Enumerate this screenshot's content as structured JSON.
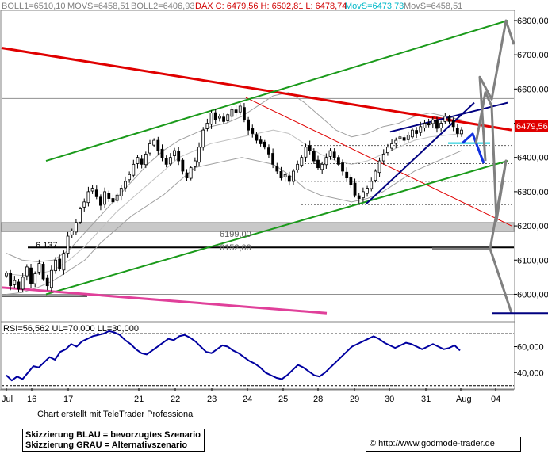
{
  "header": {
    "boll1": "BOLL1=6510,10",
    "movs": "MOVS=6458,51",
    "boll2": "BOLL2=6406,93",
    "dax": "DAX C: 6479,56 H: 6502,81 L: 6478,74",
    "movs_cyan": "MovS=6473,73",
    "movs2": "MovS=6458,51"
  },
  "rsi_header": "RSI=56,562 UL=70,000 LL=30,000",
  "footer": {
    "credit": "Chart erstellt mit TeleTrader Professional",
    "legend_blue": "Skizzierung BLAU = bevorzugtes Szenario",
    "legend_grey": "Skizzierung GRAU = Alternativszenario",
    "copyright": "© http://www.godmode-trader.de"
  },
  "colors": {
    "bg": "#ffffff",
    "red_resistance": "#e00000",
    "green_channel": "#1a9a1a",
    "navy_trend": "#000080",
    "blue_scenario": "#1030e0",
    "grey_scenario": "#808080",
    "magenta_line": "#e0409a",
    "cyan_line": "#00c8d8",
    "candle": "#000000",
    "band": "#a0a0a0",
    "price_tag": "#e00000"
  },
  "chart_data": [
    {
      "type": "candlestick",
      "title": "DAX",
      "ylim": [
        5920,
        6830
      ],
      "y_ticks": [
        "6800,00",
        "6700,00",
        "6600,00",
        "6500,00",
        "6400,00",
        "6300,00",
        "6200,00",
        "6100,00",
        "6000,00"
      ],
      "x_ticks": [
        "Jul",
        "16",
        "17",
        "21",
        "22",
        "23",
        "24",
        "25",
        "28",
        "29",
        "30",
        "31",
        "Aug",
        "04"
      ],
      "last_price": "6479,56",
      "annotations": {
        "zone_label": "6199,00",
        "line_6152": "6152,00",
        "low_label": "6.137"
      },
      "levels": {
        "zone_top": 6210,
        "zone_bottom": 6183,
        "support_6137": 6137,
        "support_6000": 6000,
        "resistance_6572": 6572,
        "dotted_6435": 6435,
        "dotted_6382": 6382,
        "dotted_6330": 6330,
        "dotted_6262": 6262
      },
      "closes": [
        6062,
        6025,
        6040,
        6015,
        6050,
        6080,
        6030,
        6060,
        6090,
        6045,
        6025,
        6070,
        6100,
        6075,
        6120,
        6170,
        6185,
        6210,
        6250,
        6270,
        6300,
        6310,
        6285,
        6260,
        6300,
        6280,
        6270,
        6290,
        6310,
        6330,
        6350,
        6380,
        6400,
        6380,
        6410,
        6440,
        6450,
        6420,
        6400,
        6380,
        6400,
        6420,
        6390,
        6360,
        6340,
        6370,
        6390,
        6430,
        6480,
        6500,
        6530,
        6510,
        6520,
        6505,
        6525,
        6540,
        6530,
        6550,
        6510,
        6480,
        6470,
        6450,
        6440,
        6430,
        6410,
        6380,
        6360,
        6340,
        6350,
        6330,
        6360,
        6380,
        6400,
        6430,
        6420,
        6390,
        6370,
        6380,
        6400,
        6420,
        6400,
        6380,
        6360,
        6340,
        6320,
        6290,
        6280,
        6300,
        6310,
        6330,
        6360,
        6390,
        6410,
        6430,
        6440,
        6450,
        6460,
        6450,
        6465,
        6480,
        6470,
        6490,
        6500,
        6495,
        6510,
        6485,
        6500,
        6520,
        6505,
        6490,
        6470,
        6480
      ],
      "bollinger": {
        "upper": [
          6120,
          6100,
          6095,
          6100,
          6130,
          6180,
          6230,
          6280,
          6330,
          6380,
          6420,
          6450,
          6470,
          6490,
          6500,
          6520,
          6550,
          6580,
          6590,
          6560,
          6520,
          6480,
          6460,
          6470,
          6490,
          6500,
          6520,
          6530,
          6520,
          6510
        ],
        "middle": [
          6060,
          6055,
          6060,
          6070,
          6100,
          6140,
          6190,
          6240,
          6280,
          6320,
          6360,
          6400,
          6420,
          6440,
          6450,
          6460,
          6470,
          6480,
          6470,
          6440,
          6410,
          6390,
          6380,
          6390,
          6410,
          6430,
          6450,
          6460,
          6465,
          6470
        ],
        "lower": [
          6000,
          6005,
          6020,
          6040,
          6070,
          6100,
          6150,
          6190,
          6230,
          6260,
          6290,
          6330,
          6370,
          6380,
          6390,
          6400,
          6390,
          6380,
          6350,
          6310,
          6290,
          6280,
          6270,
          6280,
          6300,
          6330,
          6360,
          6380,
          6400,
          6420
        ]
      },
      "trendlines": {
        "red_thick": [
          6720,
          6480
        ],
        "red_thin": [
          6575,
          6200
        ],
        "green_upper": [
          6390,
          6800
        ],
        "green_lower": [
          6000,
          6390
        ],
        "magenta": [
          6020,
          5945
        ],
        "navy_trend": [
          6265,
          6560
        ],
        "navy_upper": [
          6475,
          6560
        ]
      },
      "scenarios": {
        "blue": [
          6442,
          6469,
          6383
        ],
        "grey_upper": [
          6390,
          6635,
          6570,
          6800,
          6730
        ],
        "grey_lower": [
          6440,
          6590,
          6550,
          6215,
          6390,
          6133,
          6133,
          5945
        ]
      },
      "cyan_level": 6442
    },
    {
      "type": "line",
      "title": "RSI",
      "ylim": [
        28,
        78
      ],
      "y_ticks": [
        "60,000",
        "40,000"
      ],
      "upper_limit": 70,
      "lower_limit": 30,
      "values": [
        38,
        34,
        37,
        35,
        40,
        45,
        44,
        48,
        52,
        50,
        56,
        58,
        62,
        60,
        64,
        66,
        68,
        69,
        70,
        72,
        71,
        69,
        65,
        62,
        58,
        55,
        54,
        57,
        60,
        63,
        66,
        65,
        68,
        69,
        67,
        64,
        60,
        56,
        55,
        58,
        61,
        60,
        57,
        55,
        52,
        49,
        47,
        44,
        40,
        38,
        36,
        35,
        38,
        42,
        46,
        44,
        41,
        38,
        37,
        40,
        44,
        48,
        52,
        56,
        60,
        62,
        64,
        66,
        68,
        66,
        63,
        61,
        59,
        61,
        63,
        62,
        60,
        58,
        60,
        62,
        60,
        58,
        59,
        61,
        57
      ]
    }
  ]
}
